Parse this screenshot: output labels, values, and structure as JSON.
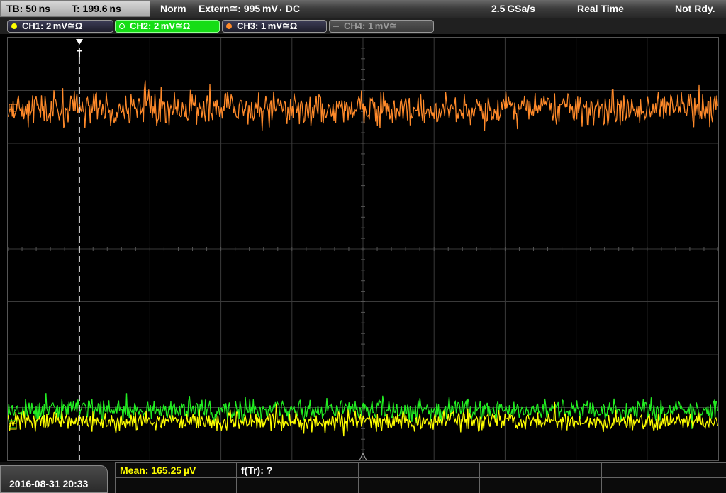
{
  "header": {
    "timebase": "TB: 50 ns",
    "trigger_time": "T: 199.6 ns",
    "trigger_mode": "Norm",
    "trigger_source": "Extern≅: 995 mV ⌐DC",
    "sample_rate": "2.5 GSa/s",
    "acq_mode": "Real Time",
    "status": "Not Rdy."
  },
  "channels": [
    {
      "label": "CH1: 2 mV≅Ω",
      "color": "#ffff00",
      "state": "on"
    },
    {
      "label": "CH2: 2 mV≅Ω",
      "color": "#16dd16",
      "state": "active"
    },
    {
      "label": "CH3: 1 mV≅Ω",
      "color": "#ff8a2a",
      "state": "on"
    },
    {
      "label": "CH4: 1 mV≅",
      "color": "#888888",
      "state": "off"
    }
  ],
  "trigger_marker": "T",
  "waveform_colors": {
    "ch1": "#ffff00",
    "ch2": "#22ee22",
    "ch3": "#ff8a2a"
  },
  "footer": {
    "datetime": "2016-08-31 20:33",
    "mean": "Mean: 165.25 µV",
    "freq": "f(Tr): ?"
  }
}
